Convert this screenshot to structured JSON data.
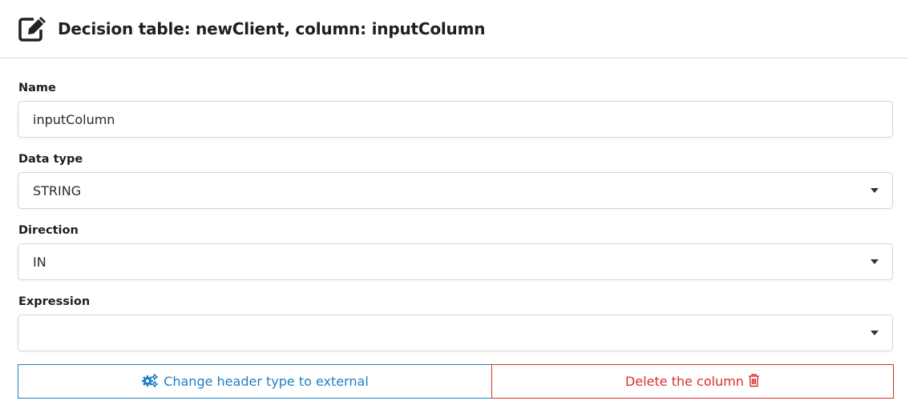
{
  "header": {
    "title": "Decision table: newClient, column: inputColumn",
    "icon": "edit-icon"
  },
  "form": {
    "name": {
      "label": "Name",
      "value": "inputColumn"
    },
    "data_type": {
      "label": "Data type",
      "value": "STRING"
    },
    "direction": {
      "label": "Direction",
      "value": "IN"
    },
    "expression": {
      "label": "Expression",
      "value": ""
    }
  },
  "actions": {
    "change_header": {
      "label": "Change header type to external",
      "icon": "cogs-icon",
      "color": "#1c7fc7"
    },
    "delete_column": {
      "label": "Delete the column",
      "icon": "trash-icon",
      "color": "#d9302b"
    }
  }
}
